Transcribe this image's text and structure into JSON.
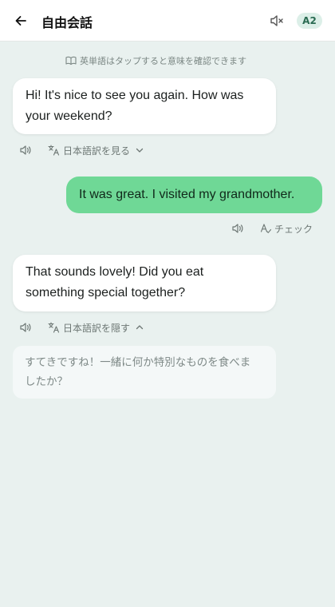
{
  "header": {
    "back_icon": "arrow-left-icon",
    "title": "自由会話",
    "mute_icon": "speaker-muted-icon",
    "level": "A2"
  },
  "hint": {
    "icon": "book-open-icon",
    "text": "英単語はタップすると意味を確認できます"
  },
  "messages": [
    {
      "role": "ai",
      "text": "Hi! It's nice to see you again. How was your weekend?",
      "lines": [
        "Hi! It's nice to see you again. How was",
        "your weekend?"
      ],
      "speak_icon": "speaker-icon",
      "translate_icon": "translate-icon",
      "translate_label": "日本語訳を見る",
      "toggle_icon": "chevron-down-icon"
    },
    {
      "role": "user",
      "text": "It was great. I visited my grandmother.",
      "speak_icon": "speaker-icon",
      "check_icon": "spell-check-icon",
      "check_label": "チェック"
    },
    {
      "role": "ai",
      "text": "That sounds lovely! Did you eat something special together?",
      "lines": [
        "That sounds lovely! Did you eat",
        "something special together?"
      ],
      "speak_icon": "speaker-icon",
      "translate_icon": "translate-icon",
      "translate_label": "日本語訳を隠す",
      "toggle_icon": "chevron-up-icon",
      "translation": "すてきですね！一緒に何か特別なものを食べましたか？",
      "translation_lines": [
        "すてきですね！一緒に何か特別なものを食べま",
        "したか？"
      ]
    }
  ],
  "colors": {
    "background": "#e9f1ef",
    "user_bubble": "#6fd896",
    "ai_bubble": "#ffffff",
    "badge_bg": "#dcefe8",
    "badge_text": "#2a6b52"
  }
}
